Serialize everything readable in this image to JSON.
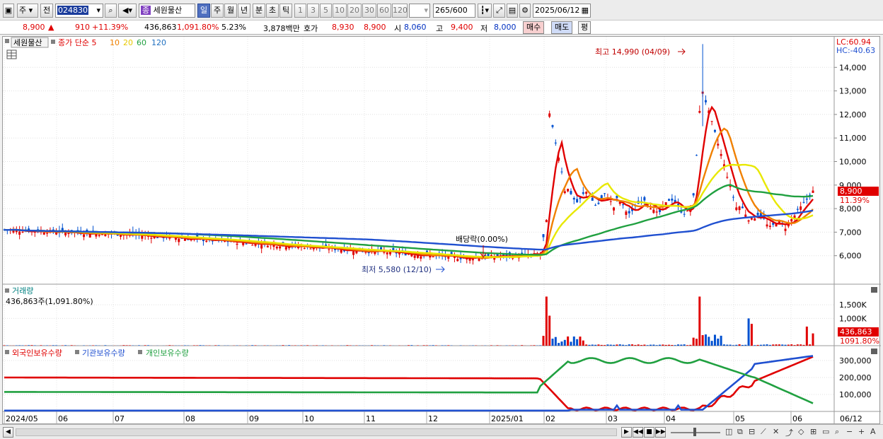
{
  "toolbar": {
    "market_label": "주",
    "prev_label": "전",
    "code": "024830",
    "stock_name": "세원물산",
    "name_prefix": "종",
    "periods": [
      "일",
      "주",
      "월",
      "년",
      "분",
      "초",
      "틱"
    ],
    "intervals": [
      "1",
      "3",
      "5",
      "10",
      "20",
      "30",
      "60",
      "120"
    ],
    "count": "265",
    "count_total": "/600",
    "date": "2025/06/12"
  },
  "quote": {
    "price": "8,900",
    "arrow": "▲",
    "change": "910",
    "change_pct": "+11.39%",
    "volume": "436,863",
    "volume_pct": "1,091.80%",
    "turnover": "5.23%",
    "amount": "3,878백만",
    "bid_label": "호가",
    "bid": "8,930",
    "ask": "8,900",
    "open_label": "시",
    "open": "8,060",
    "high_label": "고",
    "high": "9,400",
    "low_label": "저",
    "low": "8,000",
    "buy_label": "매수",
    "sell_label": "매도",
    "eval_label": "평"
  },
  "price_panel": {
    "name_tag": "세원물산",
    "ma_legend": [
      {
        "label": "종가 단순 5",
        "color": "#e00000"
      },
      {
        "label": "10",
        "color": "#f08000"
      },
      {
        "label": "20",
        "color": "#e8e800"
      },
      {
        "label": "60",
        "color": "#20a040"
      },
      {
        "label": "120",
        "color": "#2050d0"
      }
    ],
    "lc": "LC:60.94",
    "hc": "HC:-40.63",
    "y_ticks": [
      "14,000",
      "13,000",
      "12,000",
      "11,000",
      "10,000",
      "9,000",
      "8,000",
      "7,000",
      "6,000"
    ],
    "last_price_tag": "8,900",
    "last_pct_tag": "11.39%",
    "high_annotation": "최고 14,990 (04/09)",
    "low_annotation": "최저 5,580 (12/10)",
    "dividend_annotation": "배당락(0.00%)"
  },
  "volume_panel": {
    "title": "거래량",
    "value": "436,863주(1,091.80%)",
    "y_ticks": [
      "1,500K",
      "1,000K"
    ],
    "last_tag": "436,863",
    "last_pct_tag": "1091.80%"
  },
  "holdings_panel": {
    "legend": [
      {
        "label": "외국인보유수량",
        "color": "#e00000"
      },
      {
        "label": "기관보유수량",
        "color": "#2050d0"
      },
      {
        "label": "개인보유수량",
        "color": "#20a040"
      }
    ],
    "y_ticks": [
      "300,000",
      "200,000",
      "100,000"
    ]
  },
  "x_axis": [
    "2024/05",
    "06",
    "07",
    "08",
    "09",
    "10",
    "11",
    "12",
    "2025/01",
    "02",
    "03",
    "04",
    "05",
    "06",
    "06/12"
  ],
  "colors": {
    "up": "#e00000",
    "down": "#0050d0",
    "ma5": "#e00000",
    "ma10": "#f08000",
    "ma20": "#e8e800",
    "ma60": "#20a040",
    "ma120": "#2050d0"
  }
}
